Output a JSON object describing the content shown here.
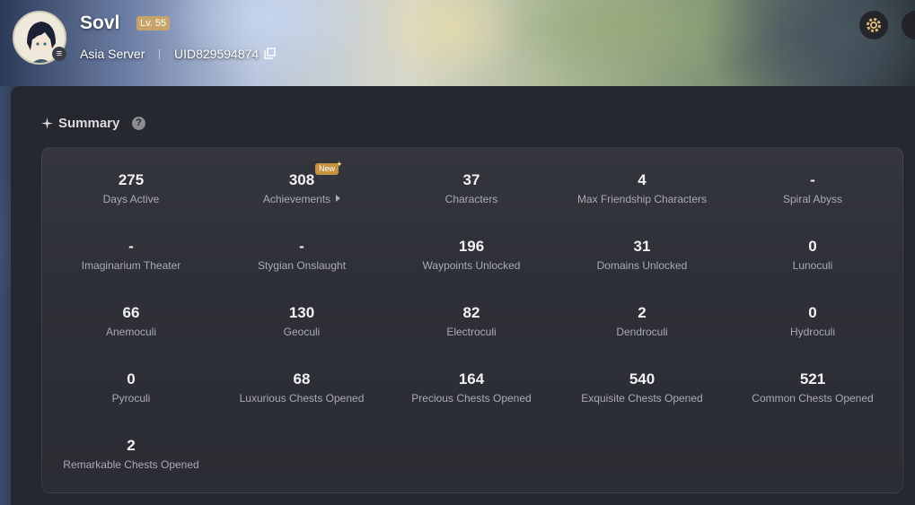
{
  "header": {
    "player_name": "Sovl",
    "level": "Lv. 55",
    "server": "Asia Server",
    "uid": "UID829594874",
    "icons": {
      "copy": "copy-icon",
      "settings": "gear-icon"
    }
  },
  "summary": {
    "title": "Summary",
    "help_icon": "?",
    "new_badge": "New",
    "stats": [
      {
        "value": "275",
        "label": "Days Active"
      },
      {
        "value": "308",
        "label": "Achievements"
      },
      {
        "value": "37",
        "label": "Characters"
      },
      {
        "value": "4",
        "label": "Max Friendship Characters"
      },
      {
        "value": "-",
        "label": "Spiral Abyss"
      },
      {
        "value": "-",
        "label": "Imaginarium Theater"
      },
      {
        "value": "-",
        "label": "Stygian Onslaught"
      },
      {
        "value": "196",
        "label": "Waypoints Unlocked"
      },
      {
        "value": "31",
        "label": "Domains Unlocked"
      },
      {
        "value": "0",
        "label": "Lunoculi"
      },
      {
        "value": "66",
        "label": "Anemoculi"
      },
      {
        "value": "130",
        "label": "Geoculi"
      },
      {
        "value": "82",
        "label": "Electroculi"
      },
      {
        "value": "2",
        "label": "Dendroculi"
      },
      {
        "value": "0",
        "label": "Hydroculi"
      },
      {
        "value": "0",
        "label": "Pyroculi"
      },
      {
        "value": "68",
        "label": "Luxurious Chests Opened"
      },
      {
        "value": "164",
        "label": "Precious Chests Opened"
      },
      {
        "value": "540",
        "label": "Exquisite Chests Opened"
      },
      {
        "value": "521",
        "label": "Common Chests Opened"
      },
      {
        "value": "2",
        "label": "Remarkable Chests Opened"
      }
    ]
  },
  "colors": {
    "accent_gold": "#c7a36a",
    "card_bg": "#2e3037",
    "label_gray": "#a9abb2"
  }
}
